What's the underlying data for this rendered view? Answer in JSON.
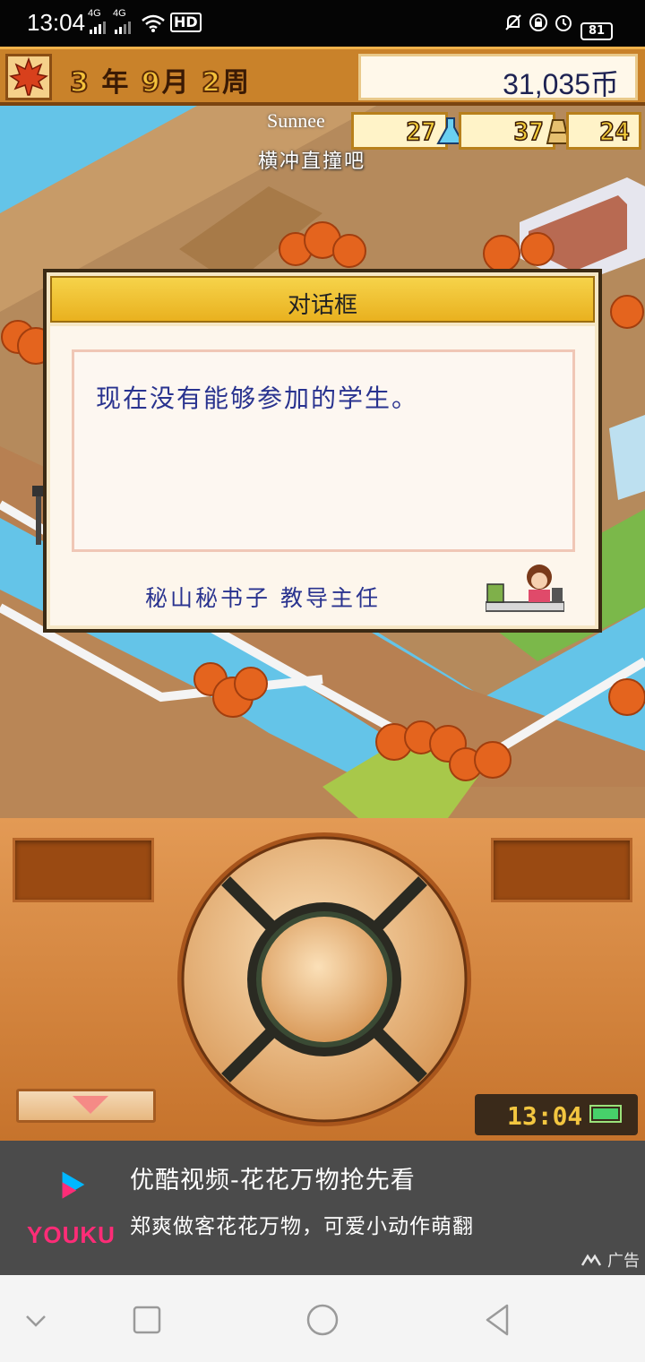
{
  "status_bar": {
    "time": "13:04",
    "signal1": "4G",
    "signal2": "4G",
    "hd_label": "HD",
    "battery": "81"
  },
  "top_bar": {
    "year": "3",
    "year_unit": "年",
    "month": "9",
    "month_unit": "月",
    "week": "2",
    "week_unit": "周",
    "money": "31,035币"
  },
  "hud": {
    "player_name": "Sunnee",
    "banner": "横冲直撞吧",
    "stats": [
      {
        "value": "27",
        "icon": "flask-icon"
      },
      {
        "value": "37",
        "icon": "weight-icon"
      },
      {
        "value": "24",
        "icon": "stat-icon"
      }
    ]
  },
  "dialog": {
    "title": "对话框",
    "message": "现在没有能够参加的学生。",
    "speaker": "秘山秘书子 教导主任"
  },
  "controller": {
    "clock": "13:04"
  },
  "ad": {
    "brand": "YOUKU",
    "title": "优酷视频-花花万物抢先看",
    "description": "郑爽做客花花万物，可爱小动作萌翻",
    "label": "广告"
  },
  "colors": {
    "dialog_text": "#29338f",
    "title_bar": "#f0c230",
    "controller": "#d9893f",
    "water": "#64c4e8"
  }
}
